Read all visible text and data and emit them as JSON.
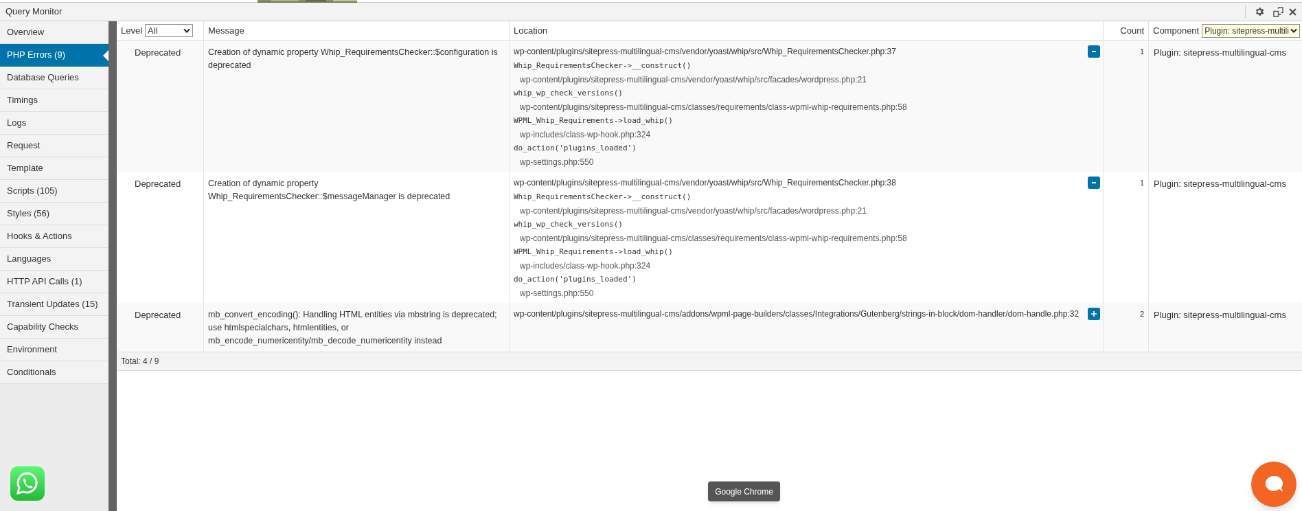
{
  "panel": {
    "title": "Query Monitor"
  },
  "sidebar": {
    "items": [
      {
        "label": "Overview",
        "selected": false
      },
      {
        "label": "PHP Errors (9)",
        "selected": true
      },
      {
        "label": "Database Queries",
        "selected": false
      },
      {
        "label": "Timings",
        "selected": false
      },
      {
        "label": "Logs",
        "selected": false
      },
      {
        "label": "Request",
        "selected": false
      },
      {
        "label": "Template",
        "selected": false
      },
      {
        "label": "Scripts (105)",
        "selected": false
      },
      {
        "label": "Styles (56)",
        "selected": false
      },
      {
        "label": "Hooks & Actions",
        "selected": false
      },
      {
        "label": "Languages",
        "selected": false
      },
      {
        "label": "HTTP API Calls (1)",
        "selected": false
      },
      {
        "label": "Transient Updates (15)",
        "selected": false
      },
      {
        "label": "Capability Checks",
        "selected": false
      },
      {
        "label": "Environment",
        "selected": false
      },
      {
        "label": "Conditionals",
        "selected": false
      }
    ]
  },
  "table": {
    "columns": [
      {
        "label": "Level",
        "filter": "All"
      },
      {
        "label": "Message"
      },
      {
        "label": "Location"
      },
      {
        "label": "Count"
      },
      {
        "label": "Component",
        "filter": "Plugin: sitepress-multili"
      }
    ],
    "rows": [
      {
        "level": "Deprecated",
        "message": "Creation of dynamic property Whip_RequirementsChecker::$configuration is deprecated",
        "expanded": true,
        "count": "1",
        "component": "Plugin: sitepress-multilingual-cms",
        "location": [
          {
            "kind": "location",
            "text": "wp-content/plugins/sitepress-multilingual-cms/vendor/yoast/whip/src/Whip_RequirementsChecker.php:37"
          },
          {
            "kind": "call",
            "text": "Whip_RequirementsChecker->__construct()"
          },
          {
            "kind": "file",
            "text": "wp-content/plugins/sitepress-multilingual-cms/vendor/yoast/whip/src/facades/wordpress.php:21"
          },
          {
            "kind": "call",
            "text": "whip_wp_check_versions()"
          },
          {
            "kind": "file",
            "text": "wp-content/plugins/sitepress-multilingual-cms/classes/requirements/class-wpml-whip-requirements.php:58"
          },
          {
            "kind": "call",
            "text": "WPML_Whip_Requirements->load_whip()"
          },
          {
            "kind": "file",
            "text": "wp-includes/class-wp-hook.php:324"
          },
          {
            "kind": "call",
            "text": "do_action('plugins_loaded')"
          },
          {
            "kind": "file",
            "text": "wp-settings.php:550"
          }
        ]
      },
      {
        "level": "Deprecated",
        "message": "Creation of dynamic property Whip_RequirementsChecker::$messageManager is deprecated",
        "expanded": true,
        "count": "1",
        "component": "Plugin: sitepress-multilingual-cms",
        "location": [
          {
            "kind": "location",
            "text": "wp-content/plugins/sitepress-multilingual-cms/vendor/yoast/whip/src/Whip_RequirementsChecker.php:38"
          },
          {
            "kind": "call",
            "text": "Whip_RequirementsChecker->__construct()"
          },
          {
            "kind": "file",
            "text": "wp-content/plugins/sitepress-multilingual-cms/vendor/yoast/whip/src/facades/wordpress.php:21"
          },
          {
            "kind": "call",
            "text": "whip_wp_check_versions()"
          },
          {
            "kind": "file",
            "text": "wp-content/plugins/sitepress-multilingual-cms/classes/requirements/class-wpml-whip-requirements.php:58"
          },
          {
            "kind": "call",
            "text": "WPML_Whip_Requirements->load_whip()"
          },
          {
            "kind": "file",
            "text": "wp-includes/class-wp-hook.php:324"
          },
          {
            "kind": "call",
            "text": "do_action('plugins_loaded')"
          },
          {
            "kind": "file",
            "text": "wp-settings.php:550"
          }
        ]
      },
      {
        "level": "Deprecated",
        "message": "mb_convert_encoding(): Handling HTML entities via mbstring is deprecated; use htmlspecialchars, htmlentities, or mb_encode_numericentity/mb_decode_numericentity instead",
        "expanded": false,
        "count": "2",
        "component": "Plugin: sitepress-multilingual-cms",
        "location": [
          {
            "kind": "location",
            "text": "wp-content/plugins/sitepress-multilingual-cms/addons/wpml-page-builders/classes/Integrations/Gutenberg/strings-in-block/dom-handler/dom-handle.php:32"
          }
        ]
      }
    ],
    "total": "Total: 4 / 9"
  },
  "tooltip": "Google Chrome"
}
